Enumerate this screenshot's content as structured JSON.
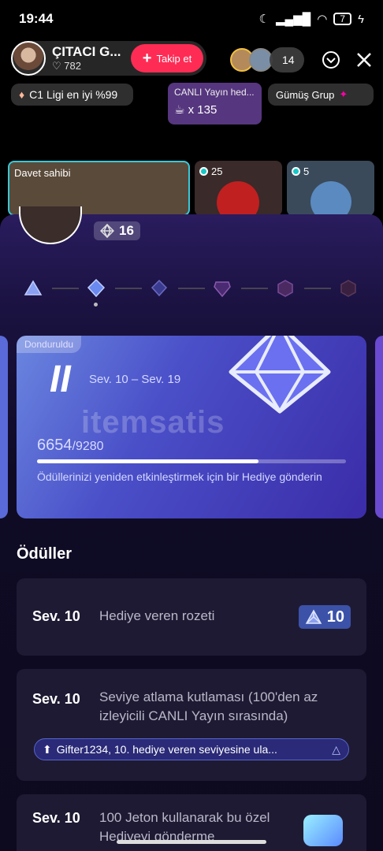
{
  "status": {
    "time": "19:44",
    "battery": "7"
  },
  "host": {
    "name": "ÇITACI G...",
    "likes": "782",
    "follow_label": "Takip et"
  },
  "viewers": {
    "count": "14",
    "badge": "1"
  },
  "chips": {
    "league": "C1 Ligi en iyi %99",
    "live_title": "CANLI Yayın hed...",
    "live_count": "x 135",
    "group": "Gümüş Grup"
  },
  "guests": [
    {
      "label": "Davet sahibi"
    },
    {
      "label": "25"
    },
    {
      "label": "5"
    }
  ],
  "level": {
    "current": "16"
  },
  "card": {
    "frozen": "Donduruldu",
    "pause": "II",
    "range": "Sev. 10 – Sev. 19",
    "progress": "6654",
    "total": "/9280",
    "progress_fraction": 0.717,
    "note": "Ödüllerinizi yeniden etkinleştirmek için bir Hediye gönderin",
    "watermark": "itemsatis"
  },
  "rewards": {
    "title": "Ödüller",
    "items": [
      {
        "level": "Sev. 10",
        "desc": "Hediye veren rozeti",
        "badge": "10"
      },
      {
        "level": "Sev. 10",
        "desc": "Seviye atlama kutlaması (100'den az izleyicili CANLI Yayın sırasında)",
        "notify": "Gifter1234, 10. hediye veren seviyesine ula..."
      },
      {
        "level": "Sev. 10",
        "desc": "100 Jeton kullanarak bu özel Hediyeyi gönderme"
      }
    ]
  },
  "colors": {
    "accent": "#fe2c55",
    "sheet": "#1a1240",
    "card": "#4a4fc8"
  }
}
